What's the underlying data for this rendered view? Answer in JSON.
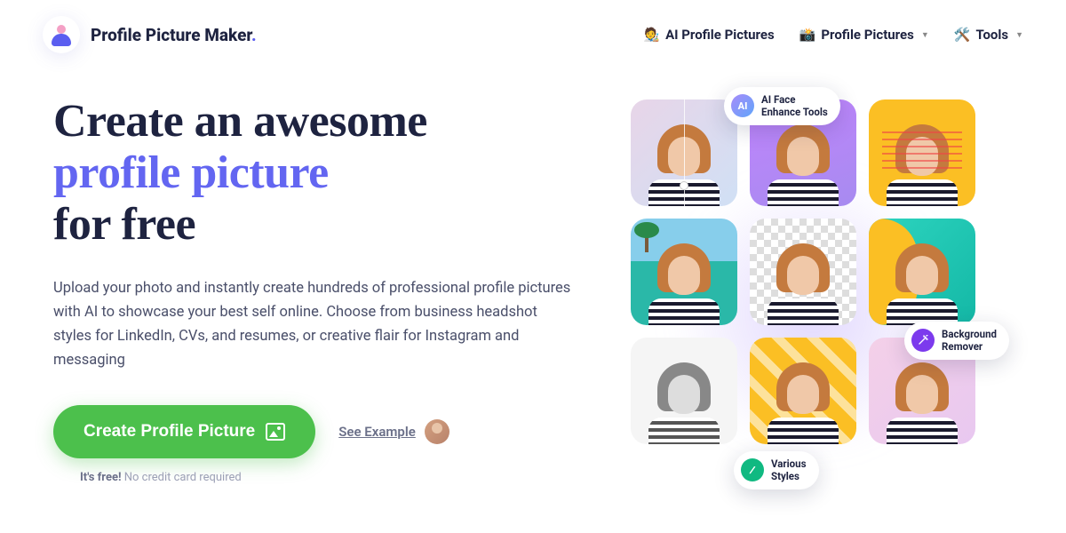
{
  "brand": {
    "name": "Profile Picture Maker",
    "dot": "."
  },
  "nav": {
    "ai": {
      "emoji": "🧑‍🎨",
      "label": "AI Profile Pictures"
    },
    "pp": {
      "emoji": "📸",
      "label": "Profile Pictures"
    },
    "tools": {
      "emoji": "🛠️",
      "label": "Tools"
    }
  },
  "hero": {
    "line1": "Create an awesome",
    "line2": "profile picture",
    "line3": "for free",
    "desc": "Upload your photo and instantly create hundreds of professional profile pictures with AI to showcase your best self online. Choose from business headshot styles for LinkedIn, CVs, and resumes, or creative flair for Instagram and messaging",
    "cta": "Create Profile Picture",
    "example_link": "See Example",
    "note_bold": "It's free!",
    "note_rest": " No credit card required"
  },
  "callouts": {
    "ai_face": {
      "icon": "AI",
      "line1": "AI Face",
      "line2": "Enhance Tools"
    },
    "bg": {
      "line1": "Background",
      "line2": "Remover"
    },
    "styles": {
      "line1": "Various",
      "line2": "Styles"
    }
  }
}
